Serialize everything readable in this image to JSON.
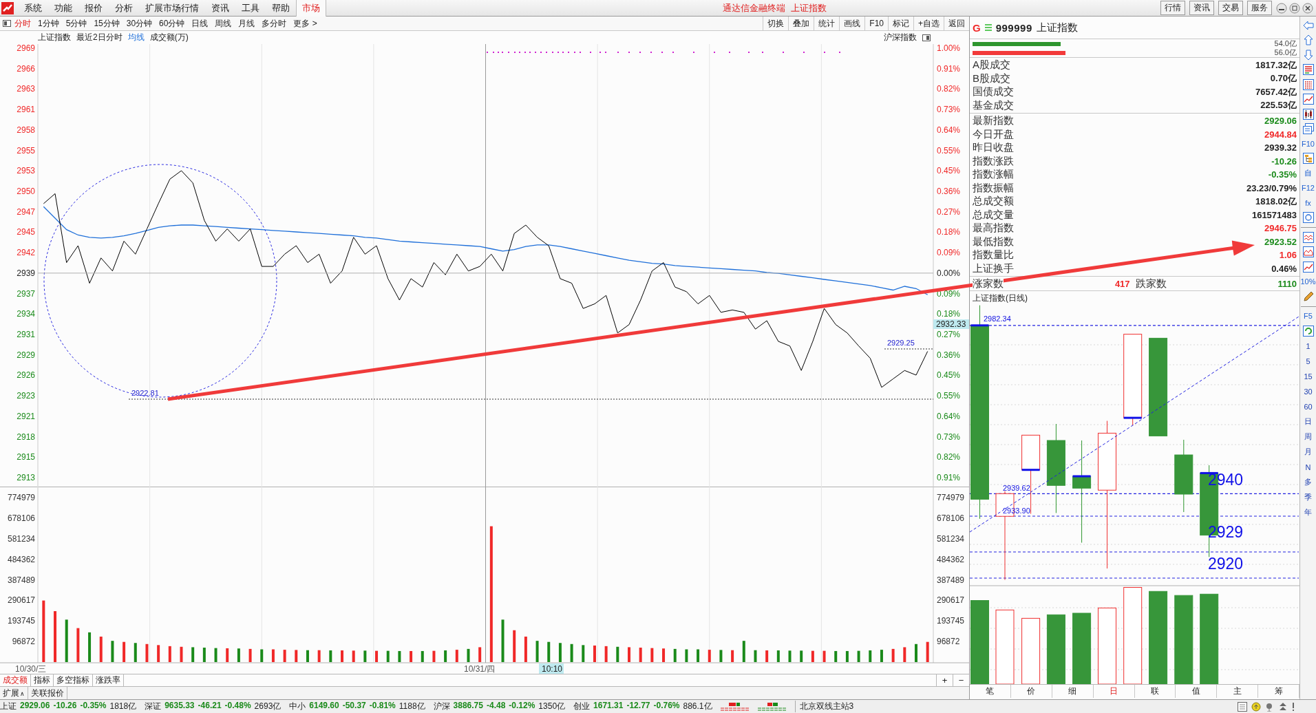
{
  "menu": {
    "items": [
      {
        "label": "系统"
      },
      {
        "label": "功能"
      },
      {
        "label": "报价"
      },
      {
        "label": "分析"
      },
      {
        "label": "扩展市场行情"
      },
      {
        "label": "资讯"
      },
      {
        "label": "工具"
      },
      {
        "label": "帮助"
      }
    ],
    "market": "市场",
    "app_title": "通达信金融终端",
    "symbol_title": "上证指数",
    "right_buttons": [
      "行情",
      "资讯",
      "交易",
      "服务"
    ]
  },
  "periods": [
    {
      "label": "分时",
      "selected": true
    },
    {
      "label": "1分钟",
      "selected": false
    },
    {
      "label": "5分钟",
      "selected": false
    },
    {
      "label": "15分钟",
      "selected": false
    },
    {
      "label": "30分钟",
      "selected": false
    },
    {
      "label": "60分钟",
      "selected": false
    },
    {
      "label": "日线",
      "selected": false
    },
    {
      "label": "周线",
      "selected": false
    },
    {
      "label": "月线",
      "selected": false
    },
    {
      "label": "多分时",
      "selected": false
    },
    {
      "label": "更多 >",
      "selected": false
    }
  ],
  "tools": [
    "切换",
    "叠加",
    "统计",
    "画线",
    "F10",
    "标记",
    "+自选",
    "返回"
  ],
  "chart_header": {
    "range": "最近2日分时",
    "volume_label": "成交额(万)",
    "market": "沪深指数"
  },
  "intraday": {
    "dates": [
      "10/30/三",
      "10/31/四"
    ],
    "cursor_time": "10:10",
    "pct_axis": [
      {
        "label": "1.00%",
        "color": "#f02828"
      },
      {
        "label": "0.91%",
        "color": "#f02828"
      },
      {
        "label": "0.82%",
        "color": "#f02828"
      },
      {
        "label": "0.73%",
        "color": "#f02828"
      },
      {
        "label": "0.64%",
        "color": "#f02828"
      },
      {
        "label": "0.55%",
        "color": "#f02828"
      },
      {
        "label": "0.45%",
        "color": "#f02828"
      },
      {
        "label": "0.36%",
        "color": "#f02828"
      },
      {
        "label": "0.27%",
        "color": "#f02828"
      },
      {
        "label": "0.18%",
        "color": "#f02828"
      },
      {
        "label": "0.09%",
        "color": "#f02828"
      },
      {
        "label": "0.00%",
        "color": "#222222"
      },
      {
        "label": "0.09%",
        "color": "#1a8a1a"
      },
      {
        "label": "0.18%",
        "color": "#1a8a1a"
      },
      {
        "label": "0.27%",
        "color": "#1a8a1a"
      },
      {
        "label": "0.36%",
        "color": "#1a8a1a"
      },
      {
        "label": "0.45%",
        "color": "#1a8a1a"
      },
      {
        "label": "0.55%",
        "color": "#1a8a1a"
      },
      {
        "label": "0.64%",
        "color": "#1a8a1a"
      },
      {
        "label": "0.73%",
        "color": "#1a8a1a"
      },
      {
        "label": "0.82%",
        "color": "#1a8a1a"
      },
      {
        "label": "0.91%",
        "color": "#1a8a1a"
      }
    ],
    "chart_data": {
      "type": "line",
      "ylim": [
        2911.43,
        2969.25
      ],
      "yticks": [
        {
          "value": 2968.71,
          "label": "2969"
        },
        {
          "value": 2966.04,
          "label": "2966"
        },
        {
          "value": 2963.37,
          "label": "2963"
        },
        {
          "value": 2960.69,
          "label": "2961"
        },
        {
          "value": 2958.02,
          "label": "2958"
        },
        {
          "value": 2955.35,
          "label": "2955"
        },
        {
          "value": 2952.68,
          "label": "2953"
        },
        {
          "value": 2950.0,
          "label": "2950"
        },
        {
          "value": 2947.33,
          "label": "2947"
        },
        {
          "value": 2944.66,
          "label": "2945"
        },
        {
          "value": 2941.99,
          "label": "2942"
        },
        {
          "value": 2939.32,
          "label": "2939"
        },
        {
          "value": 2936.65,
          "label": "2937"
        },
        {
          "value": 2933.97,
          "label": "2934"
        },
        {
          "value": 2931.3,
          "label": "2931"
        },
        {
          "value": 2928.63,
          "label": "2929"
        },
        {
          "value": 2925.96,
          "label": "2926"
        },
        {
          "value": 2923.29,
          "label": "2923"
        },
        {
          "value": 2920.61,
          "label": "2921"
        },
        {
          "value": 2917.94,
          "label": "2918"
        },
        {
          "value": 2915.27,
          "label": "2915"
        },
        {
          "value": 2912.6,
          "label": "2913"
        }
      ],
      "series": [
        {
          "name": "上证指数",
          "color": "#000000",
          "values": [
            2948.4,
            2949.7,
            2940.7,
            2942.9,
            2938.0,
            2941.3,
            2939.6,
            2943.5,
            2941.8,
            2945.1,
            2948.4,
            2951.6,
            2952.7,
            2951.1,
            2946.2,
            2943.5,
            2945.1,
            2943.5,
            2945.1,
            2940.2,
            2940.2,
            2941.8,
            2942.9,
            2940.7,
            2941.8,
            2938.0,
            2939.6,
            2944.0,
            2941.8,
            2942.9,
            2938.6,
            2935.8,
            2938.6,
            2937.5,
            2940.7,
            2939.1,
            2941.8,
            2939.6,
            2940.2,
            2941.8,
            2939.6,
            2944.5,
            2945.6,
            2944.0,
            2942.9,
            2938.6,
            2938.0,
            2934.7,
            2935.3,
            2936.4,
            2931.5,
            2932.6,
            2935.8,
            2939.6,
            2940.7,
            2937.5,
            2936.9,
            2935.3,
            2936.4,
            2934.2,
            2934.5,
            2934.2,
            2932.0,
            2933.1,
            2930.4,
            2929.8,
            2926.6,
            2930.4,
            2934.7,
            2932.6,
            2931.5,
            2929.8,
            2928.2,
            2924.4,
            2925.5,
            2926.6,
            2926.0,
            2929.1
          ]
        },
        {
          "name": "均线",
          "color": "#1e6fd9",
          "values": [
            2948.0,
            2946.5,
            2945.0,
            2944.3,
            2944.0,
            2943.9,
            2944.0,
            2944.2,
            2944.5,
            2944.9,
            2945.3,
            2945.5,
            2945.6,
            2945.6,
            2945.5,
            2945.4,
            2945.3,
            2945.2,
            2945.1,
            2945.0,
            2944.9,
            2944.8,
            2944.7,
            2944.6,
            2944.5,
            2944.4,
            2944.3,
            2944.2,
            2944.0,
            2943.9,
            2943.7,
            2943.5,
            2943.4,
            2943.3,
            2943.2,
            2943.1,
            2943.0,
            2942.9,
            2942.8,
            2942.5,
            2942.2,
            2942.4,
            2942.8,
            2943.0,
            2943.0,
            2942.8,
            2942.5,
            2942.2,
            2941.9,
            2941.6,
            2941.3,
            2941.0,
            2940.8,
            2940.6,
            2940.5,
            2940.3,
            2940.2,
            2940.1,
            2940.0,
            2939.9,
            2939.8,
            2939.7,
            2939.6,
            2939.4,
            2939.3,
            2939.1,
            2938.9,
            2938.7,
            2938.5,
            2938.3,
            2938.1,
            2937.9,
            2937.7,
            2937.4,
            2937.1,
            2937.6,
            2937.3,
            2936.5
          ]
        }
      ],
      "annotations": [
        "2922.81",
        "2929.25",
        "2932.33"
      ]
    }
  },
  "volume": {
    "chart_data": {
      "type": "bar",
      "ylim": [
        0,
        826900
      ],
      "yticks": [
        {
          "value": 774979,
          "label": "774979"
        },
        {
          "value": 678106,
          "label": "678106"
        },
        {
          "value": 581234,
          "label": "581234"
        },
        {
          "value": 484362,
          "label": "484362"
        },
        {
          "value": 387489,
          "label": "387489"
        },
        {
          "value": 290617,
          "label": "290617"
        },
        {
          "value": 193745,
          "label": "193745"
        },
        {
          "value": 96872,
          "label": "96872"
        }
      ],
      "values": [
        290000,
        240000,
        200000,
        160000,
        140000,
        120000,
        100000,
        95000,
        90000,
        85000,
        80000,
        75000,
        72000,
        70000,
        68000,
        66000,
        65000,
        64000,
        62000,
        60000,
        60000,
        58000,
        57000,
        56000,
        56000,
        55000,
        55000,
        54000,
        54000,
        53000,
        53000,
        52000,
        52000,
        52000,
        53000,
        55000,
        58000,
        62000,
        70000,
        640000,
        200000,
        150000,
        120000,
        100000,
        95000,
        90000,
        85000,
        80000,
        78000,
        75000,
        72000,
        70000,
        68000,
        66000,
        64000,
        62000,
        60000,
        60000,
        58000,
        57000,
        56000,
        100000,
        56000,
        55000,
        55000,
        54000,
        54000,
        53000,
        53000,
        52000,
        52000,
        53000,
        55000,
        58000,
        62000,
        70000,
        85000,
        95000
      ]
    }
  },
  "indicator_tabs": [
    {
      "label": "成交额",
      "selected": true
    },
    {
      "label": "指标",
      "selected": false
    },
    {
      "label": "多空指标",
      "selected": false
    },
    {
      "label": "涨跌率",
      "selected": false
    }
  ],
  "zoom_buttons": [
    "+",
    "−"
  ],
  "extension": {
    "label": "扩展",
    "caret": "∧",
    "link": "关联报价"
  },
  "quote": {
    "flag": "G",
    "code": "999999",
    "name": "上证指数"
  },
  "flow_bars": [
    {
      "color": "#2e962e",
      "level": 0.3,
      "value": "54.0亿"
    },
    {
      "color": "#f23a3a",
      "level": 0.315,
      "value": "56.0亿"
    }
  ],
  "turnover": [
    {
      "label": "A股成交",
      "value": "1817.32亿"
    },
    {
      "label": "B股成交",
      "value": "0.70亿"
    },
    {
      "label": "国债成交",
      "value": "7657.42亿"
    },
    {
      "label": "基金成交",
      "value": "225.53亿"
    }
  ],
  "stats": [
    {
      "label": "最新指数",
      "value": "2929.06",
      "color": "#1a8a1a"
    },
    {
      "label": "今日开盘",
      "value": "2944.84",
      "color": "#f02828"
    },
    {
      "label": "昨日收盘",
      "value": "2939.32",
      "color": "#222222"
    },
    {
      "label": "指数涨跌",
      "value": "-10.26",
      "color": "#1a8a1a"
    },
    {
      "label": "指数涨幅",
      "value": "-0.35%",
      "color": "#1a8a1a"
    },
    {
      "label": "指数振幅",
      "value": "23.23/0.79%",
      "color": "#222222"
    },
    {
      "label": "总成交额",
      "value": "1818.02亿",
      "color": "#222222"
    },
    {
      "label": "总成交量",
      "value": "161571483",
      "color": "#222222"
    },
    {
      "label": "最高指数",
      "value": "2946.75",
      "color": "#f02828"
    },
    {
      "label": "最低指数",
      "value": "2923.52",
      "color": "#1a8a1a"
    },
    {
      "label": "指数量比",
      "value": "1.06",
      "color": "#f02828"
    },
    {
      "label": "上证换手",
      "value": "0.46%",
      "color": "#222222"
    }
  ],
  "breadth": {
    "up_label": "涨家数",
    "up_count": "417",
    "down_label": "跌家数",
    "down_count": "1110"
  },
  "kline": {
    "title": "上证指数(日线)",
    "labels": [
      {
        "text": "2982.34",
        "kind": "price"
      },
      {
        "text": "2939.62",
        "kind": "price"
      },
      {
        "text": "2933.90",
        "kind": "price"
      },
      {
        "text": "2940",
        "kind": "level"
      },
      {
        "text": "2929",
        "kind": "level"
      },
      {
        "text": "2920",
        "kind": "level"
      }
    ]
  },
  "kline_tabs": [
    {
      "label": "笔",
      "selected": false
    },
    {
      "label": "价",
      "selected": false
    },
    {
      "label": "细",
      "selected": false
    },
    {
      "label": "日",
      "selected": true
    },
    {
      "label": "联",
      "selected": false
    },
    {
      "label": "值",
      "selected": false
    },
    {
      "label": "主",
      "selected": false
    },
    {
      "label": "筹",
      "selected": false
    }
  ],
  "side_tools": [
    [
      {
        "kind": "arrow-left"
      },
      {
        "kind": "arrow-up"
      },
      {
        "kind": "arrow-down"
      },
      {
        "kind": "table"
      },
      {
        "kind": "grid"
      },
      {
        "kind": "line"
      },
      {
        "kind": "candle"
      },
      {
        "kind": "doc"
      },
      {
        "kind": "text",
        "label": "F10"
      },
      {
        "kind": "tree"
      },
      {
        "kind": "text",
        "label": "自"
      },
      {
        "kind": "text",
        "label": "F12"
      },
      {
        "kind": "text",
        "label": "fx"
      },
      {
        "kind": "circle"
      }
    ],
    [
      {
        "kind": "wave"
      },
      {
        "kind": "area"
      },
      {
        "kind": "line"
      },
      {
        "kind": "text",
        "label": "10%"
      },
      {
        "kind": "pencil"
      }
    ],
    [
      {
        "kind": "text",
        "label": "F5"
      },
      {
        "kind": "refresh"
      },
      {
        "kind": "period",
        "label": "1"
      },
      {
        "kind": "period",
        "label": "5"
      },
      {
        "kind": "period",
        "label": "15"
      },
      {
        "kind": "period",
        "label": "30"
      },
      {
        "kind": "period",
        "label": "60"
      },
      {
        "kind": "period",
        "label": "日"
      },
      {
        "kind": "period",
        "label": "周"
      },
      {
        "kind": "period",
        "label": "月"
      },
      {
        "kind": "period",
        "label": "N"
      },
      {
        "kind": "period",
        "label": "多"
      },
      {
        "kind": "period",
        "label": "季"
      },
      {
        "kind": "period",
        "label": "年"
      }
    ]
  ],
  "status": {
    "indices": [
      {
        "name": "上证",
        "value": "2929.06",
        "change": "-10.26",
        "pct": "-0.35%",
        "amount": "1818亿",
        "color": "#1a8a1a"
      },
      {
        "name": "深证",
        "value": "9635.33",
        "change": "-46.21",
        "pct": "-0.48%",
        "amount": "2693亿",
        "color": "#1a8a1a"
      },
      {
        "name": "中小",
        "value": "6149.60",
        "change": "-50.37",
        "pct": "-0.81%",
        "amount": "1188亿",
        "color": "#1a8a1a"
      },
      {
        "name": "沪深",
        "value": "3886.75",
        "change": "-4.48",
        "pct": "-0.12%",
        "amount": "1350亿",
        "color": "#1a8a1a"
      },
      {
        "name": "创业",
        "value": "1671.31",
        "change": "-12.77",
        "pct": "-0.76%",
        "amount": "886.1亿",
        "color": "#1a8a1a"
      }
    ],
    "server": "北京双线主站3"
  }
}
